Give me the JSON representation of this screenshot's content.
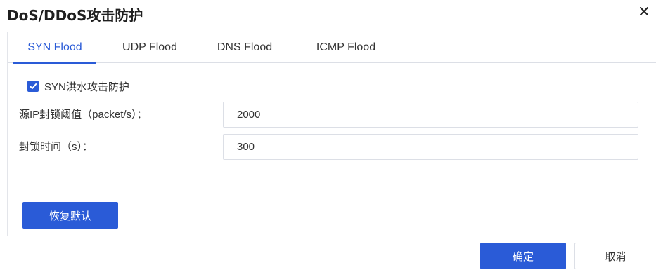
{
  "dialog": {
    "title": "DoS/DDoS攻击防护",
    "close_icon": "close-icon"
  },
  "tabs": [
    {
      "label": "SYN Flood",
      "active": true
    },
    {
      "label": "UDP Flood",
      "active": false
    },
    {
      "label": "DNS Flood",
      "active": false
    },
    {
      "label": "ICMP Flood",
      "active": false
    }
  ],
  "syn": {
    "checkbox_label": "SYN洪水攻击防护",
    "checked": true,
    "threshold_label": "源IP封锁阈值（packet/s）：",
    "threshold_value": "2000",
    "duration_label": "封锁时间（s）：",
    "duration_value": "300",
    "restore_label": "恢复默认"
  },
  "footer": {
    "confirm_label": "确定",
    "cancel_label": "取消"
  },
  "colors": {
    "accent": "#2a5bd7",
    "border": "#dcdfe6",
    "text": "#333333"
  }
}
